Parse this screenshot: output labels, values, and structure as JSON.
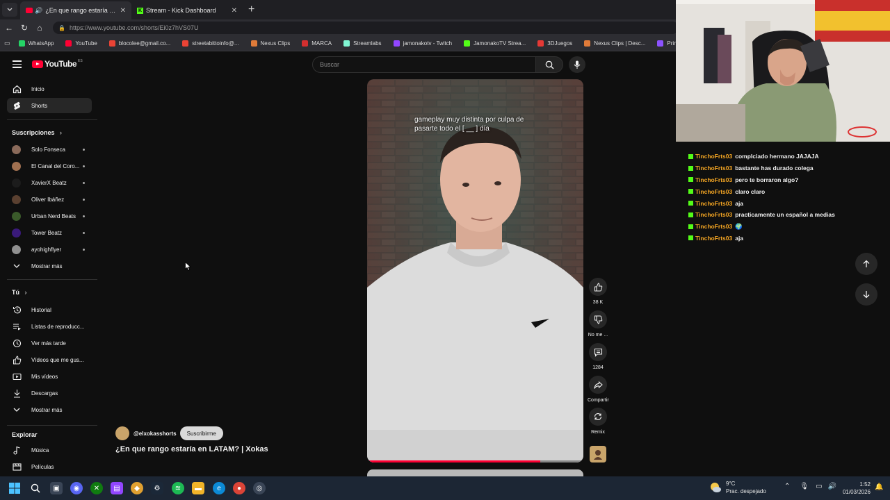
{
  "browser": {
    "tabs": [
      {
        "label": "¿En que rango estaría en LATA",
        "active": true,
        "favicon": "youtube-icon"
      },
      {
        "label": "Stream - Kick Dashboard",
        "active": false,
        "favicon": "kick-icon"
      }
    ],
    "url": "https://www.youtube.com/shorts/Ei0z7hVS07U",
    "bookmarks": [
      {
        "label": "WhatsApp",
        "color": "#25d366"
      },
      {
        "label": "YouTube",
        "color": "#ff0033"
      },
      {
        "label": "blocolee@gmail.co...",
        "color": "#ea4335"
      },
      {
        "label": "streetabittoinfo@...",
        "color": "#ea4335"
      },
      {
        "label": "Nexus Clips",
        "color": "#e07b39"
      },
      {
        "label": "MARCA",
        "color": "#d32f2f"
      },
      {
        "label": "Streamlabs",
        "color": "#80f5d2"
      },
      {
        "label": "jamonakotv - Twitch",
        "color": "#9146ff"
      },
      {
        "label": "JamonakoTV Strea...",
        "color": "#53fc18"
      },
      {
        "label": "3DJuegos",
        "color": "#e53935"
      },
      {
        "label": "Nexus Clips | Desc...",
        "color": "#e07b39"
      },
      {
        "label": "Prime",
        "color": "#8c52ff"
      }
    ]
  },
  "youtube": {
    "logo_text": "YouTube",
    "country_code": "ES",
    "search_placeholder": "Buscar",
    "nav": [
      {
        "label": "Inicio",
        "icon": "home-icon"
      },
      {
        "label": "Shorts",
        "icon": "shorts-icon"
      }
    ],
    "subscriptions_title": "Suscripciones",
    "subscriptions": [
      {
        "label": "Solo Fonseca",
        "color": "#8a6a5a"
      },
      {
        "label": "El Canal del Coro...",
        "color": "#a07050"
      },
      {
        "label": "XavierX Beatz",
        "color": "#1c1c1c"
      },
      {
        "label": "Oliver Ibáñez",
        "color": "#5a4030"
      },
      {
        "label": "Urban Nerd Beats",
        "color": "#3a5a2a"
      },
      {
        "label": "Tower Beatz",
        "color": "#3a1a7a"
      },
      {
        "label": "ayohighflyer",
        "color": "#909090"
      }
    ],
    "show_more": "Mostrar más",
    "you_title": "Tú",
    "you_items": [
      {
        "label": "Historial",
        "icon": "history-icon"
      },
      {
        "label": "Listas de reproducc...",
        "icon": "playlists-icon"
      },
      {
        "label": "Ver más tarde",
        "icon": "watch-later-icon"
      },
      {
        "label": "Vídeos que me gus...",
        "icon": "liked-icon"
      },
      {
        "label": "Mis vídeos",
        "icon": "my-videos-icon"
      },
      {
        "label": "Descargas",
        "icon": "downloads-icon"
      },
      {
        "label": "Mostrar más",
        "icon": "chevron-down-icon"
      }
    ],
    "explore_title": "Explorar",
    "explore_items": [
      {
        "label": "Música",
        "icon": "music-icon"
      },
      {
        "label": "Películas",
        "icon": "movies-icon"
      }
    ],
    "short": {
      "caption_line1": "gameplay muy distinta por culpa de",
      "caption_line2": "pasarte todo el [ __ ] día",
      "progress": 0.8,
      "channel": "@elxokasshorts",
      "subscribe_label": "Suscribirme",
      "title": "¿En que rango estaría en LATAM? | Xokas",
      "actions": {
        "likes": "38 K",
        "dislike": "No me ...",
        "comments": "1284",
        "share": "Compartir",
        "remix": "Remix"
      }
    }
  },
  "chat": [
    {
      "user": "TinchoFrts03",
      "msg": "complciado hermano JAJAJA"
    },
    {
      "user": "TinchoFrts03",
      "msg": "bastante has durado colega"
    },
    {
      "user": "TinchoFrts03",
      "msg": "pero te borraron algo?"
    },
    {
      "user": "TinchoFrts03",
      "msg": "claro claro"
    },
    {
      "user": "TinchoFrts03",
      "msg": "aja"
    },
    {
      "user": "TinchoFrts03",
      "msg": "practicamente un español a medias"
    },
    {
      "user": "TinchoFrts03",
      "msg": "🌍"
    },
    {
      "user": "TinchoFrts03",
      "msg": "aja"
    }
  ],
  "taskbar": {
    "temperature": "9°C",
    "weather": "Prac. despejado",
    "time": "1:52",
    "date": "01/03/2026"
  }
}
